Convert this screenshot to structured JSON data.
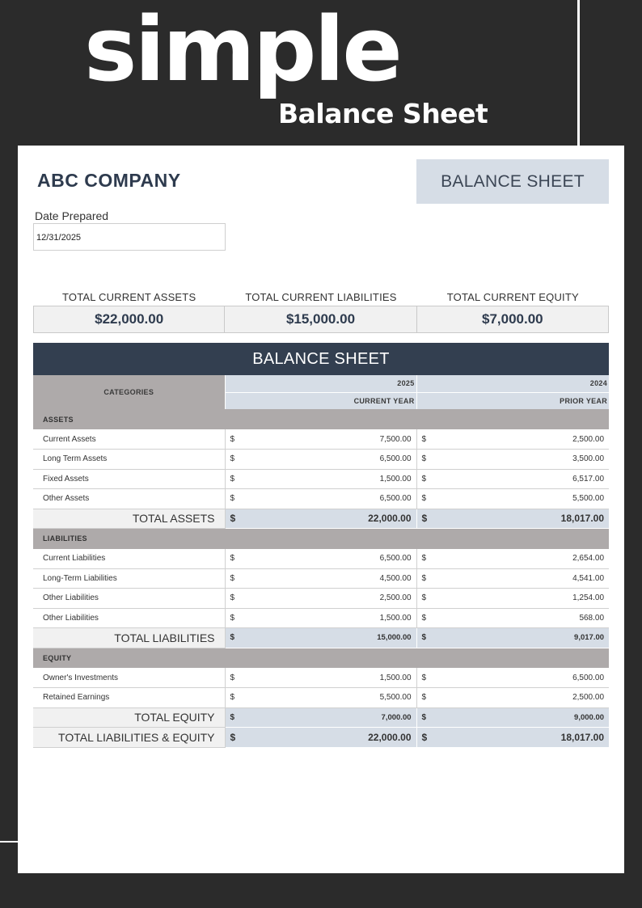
{
  "hero": {
    "title": "simple",
    "subtitle": "Balance Sheet"
  },
  "header": {
    "company": "ABC COMPANY",
    "badge": "BALANCE SHEET",
    "date_label": "Date Prepared",
    "date_value": "12/31/2025"
  },
  "summary": [
    {
      "label": "TOTAL CURRENT ASSETS",
      "value": "$22,000.00"
    },
    {
      "label": "TOTAL CURRENT LIABILITIES",
      "value": "$15,000.00"
    },
    {
      "label": "TOTAL CURRENT EQUITY",
      "value": "$7,000.00"
    }
  ],
  "sheet": {
    "title": "BALANCE SHEET",
    "categories_header": "CATEGORIES",
    "year_current": "2025",
    "year_prior": "2024",
    "current_label": "CURRENT YEAR",
    "prior_label": "PRIOR YEAR",
    "currency": "$"
  },
  "sections": [
    {
      "name": "ASSETS",
      "rows": [
        {
          "label": "Current Assets",
          "current": "7,500.00",
          "prior": "2,500.00"
        },
        {
          "label": "Long Term Assets",
          "current": "6,500.00",
          "prior": "3,500.00"
        },
        {
          "label": "Fixed Assets",
          "current": "1,500.00",
          "prior": "6,517.00"
        },
        {
          "label": "Other Assets",
          "current": "6,500.00",
          "prior": "5,500.00"
        }
      ],
      "total": {
        "label": "TOTAL ASSETS",
        "current": "22,000.00",
        "prior": "18,017.00"
      }
    },
    {
      "name": "LIABILITIES",
      "rows": [
        {
          "label": "Current Liabilities",
          "current": "6,500.00",
          "prior": "2,654.00"
        },
        {
          "label": "Long-Term Liabilities",
          "current": "4,500.00",
          "prior": "4,541.00"
        },
        {
          "label": "Other Liabilities",
          "current": "2,500.00",
          "prior": "1,254.00"
        },
        {
          "label": "Other Liabilities",
          "current": "1,500.00",
          "prior": "568.00"
        }
      ],
      "total": {
        "label": "TOTAL LIABILITIES",
        "current": "15,000.00",
        "prior": "9,017.00"
      }
    },
    {
      "name": "EQUITY",
      "rows": [
        {
          "label": "Owner's Investments",
          "current": "1,500.00",
          "prior": "6,500.00"
        },
        {
          "label": "Retained Earnings",
          "current": "5,500.00",
          "prior": "2,500.00"
        }
      ],
      "total": {
        "label": "TOTAL EQUITY",
        "current": "7,000.00",
        "prior": "9,000.00"
      }
    }
  ],
  "grand_total": {
    "label": "TOTAL LIABILITIES & EQUITY",
    "current": "22,000.00",
    "prior": "18,017.00"
  }
}
